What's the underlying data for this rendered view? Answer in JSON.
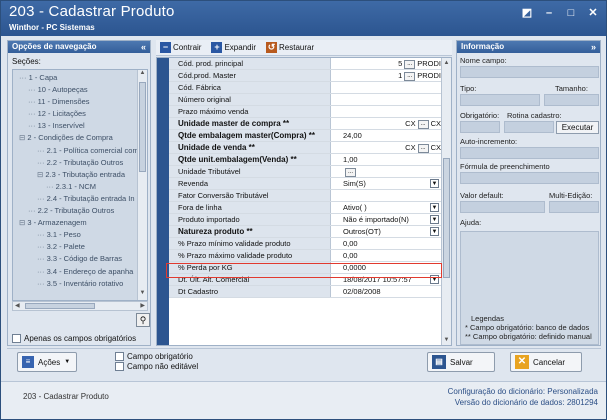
{
  "window": {
    "title": "203 - Cadastrar  Produto",
    "subtitle": "Winthor - PC Sistemas",
    "controls": [
      "◩",
      "–",
      "□",
      "✕"
    ]
  },
  "nav": {
    "header": "Opções de navegação",
    "collapse": "«",
    "sections_label": "Seções:",
    "tree": [
      "1 - Capa",
      "10 - Autopeças",
      "11 - Dimensões",
      "12 - Licitações",
      "13 - Inservível",
      "2 - Condições de Compra",
      "2.1 - Política comercial com",
      "2.2 - Tributação Outros",
      "2.3 - Tributação entrada",
      "2.3.1 - NCM",
      "2.4 - Tributação entrada In",
      "2.2 - Tributação Outros",
      "3 - Armazenagem",
      "3.1 - Peso",
      "3.2 - Palete",
      "3.3 - Código de Barras",
      "3.4 - Endereço de apanha",
      "3.5 - Inventário rotativo"
    ],
    "only_required_label": "Apenas os campos obrigatórios"
  },
  "toolbar": {
    "contrair": "Contrair",
    "expandir": "Expandir",
    "restaurar": "Restaurar"
  },
  "grid": {
    "rows": [
      {
        "label": "Cód. prod. principal",
        "value": "5",
        "suffix": "PRODI",
        "btn": true,
        "bold": false
      },
      {
        "label": "Cód.prod. Master",
        "value": "1",
        "suffix": "PRODI",
        "btn": true,
        "bold": false
      },
      {
        "label": "Cód. Fábrica",
        "value": "",
        "bold": false
      },
      {
        "label": "Número original",
        "value": "",
        "bold": false
      },
      {
        "label": "Prazo máximo venda",
        "value": "",
        "bold": false
      },
      {
        "label": "Unidade master de compra **",
        "value": "CX",
        "suffix": "CX",
        "btn": true,
        "bold": true
      },
      {
        "label": "Qtde embalagem master(Compra) **",
        "value": "24,00",
        "bold": true
      },
      {
        "label": "Unidade de venda **",
        "value": "CX",
        "suffix": "CX",
        "btn": true,
        "bold": true
      },
      {
        "label": "Qtde unit.embalagem(Venda) **",
        "value": "1,00",
        "bold": true
      },
      {
        "label": "Unidade Tributável",
        "value": "",
        "btn": true,
        "bold": false
      },
      {
        "label": "Revenda",
        "value": "Sim(S)",
        "dd": true,
        "bold": false
      },
      {
        "label": "Fator Conversão Tributável",
        "value": "",
        "bold": false
      },
      {
        "label": "Fora de linha",
        "value": "Ativo( )",
        "dd": true,
        "bold": false
      },
      {
        "label": "Produto importado",
        "value": "Não é importado(N)",
        "dd": true,
        "bold": false
      },
      {
        "label": "Natureza produto **",
        "value": "Outros(OT)",
        "dd": true,
        "bold": true
      },
      {
        "label": "% Prazo mínimo validade produto",
        "value": "0,00",
        "bold": false
      },
      {
        "label": "% Prazo máximo validade produto",
        "value": "0,00",
        "bold": false
      },
      {
        "label": "% Perda por KG",
        "value": "0,0000",
        "bold": false
      },
      {
        "label": "Dt. Últ. Alt. Comercial",
        "value": "18/08/2017 10:57:57",
        "dd": true,
        "bold": false
      },
      {
        "label": "Dt Cadastro",
        "value": "02/08/2008",
        "bold": false
      }
    ]
  },
  "info": {
    "header": "Informação",
    "expand": "»",
    "nome_campo": "Nome campo:",
    "tipo": "Tipo:",
    "tamanho": "Tamanho:",
    "obrigatorio": "Obrigatório:",
    "rotina_cadastro": "Rotina cadastro:",
    "executar": "Executar",
    "auto_incremento": "Auto-incremento:",
    "formula": "Fórmula de preenchimento",
    "valor_default": "Valor default:",
    "multi_edicao": "Multi-Edição:",
    "ajuda": "Ajuda:",
    "legendas_title": "Legendas",
    "legenda1": "* Campo obrigatório: banco de dados",
    "legenda2": "** Campo obrigatório: definido manual"
  },
  "bottom": {
    "acoes": "Ações",
    "campo_obrigatorio": "Campo obrigatório",
    "campo_nao_editavel": "Campo não editável",
    "salvar": "Salvar",
    "cancelar": "Cancelar"
  },
  "status": {
    "routine": "203 - Cadastrar  Produto",
    "config_label": "Configuração do dicionário:",
    "config_value": "Personalizada",
    "version_label": "Versão do dicionário de dados:",
    "version_value": "2801294"
  },
  "colors": {
    "title_bar": "#2c5590",
    "selection_outline": "#e13a2f",
    "panel_bg": "#dfe6ef"
  }
}
